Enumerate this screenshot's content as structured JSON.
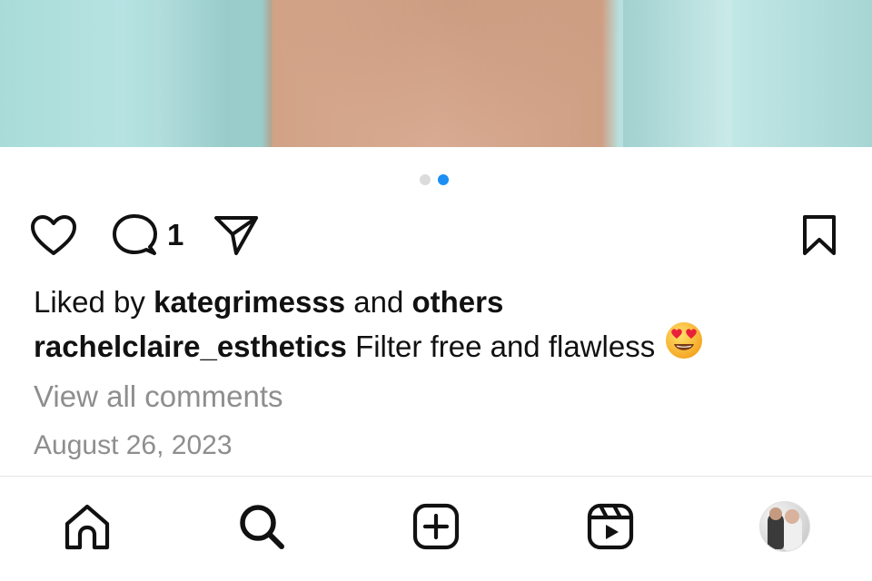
{
  "post": {
    "carousel": {
      "total": 2,
      "active_index": 1
    },
    "comment_count": "1",
    "likes": {
      "prefix": "Liked by",
      "user": "kategrimesss",
      "joiner": "and",
      "others": "others"
    },
    "caption": {
      "username": "rachelclaire_esthetics",
      "text": "Filter free and flawless"
    },
    "view_all_comments": "View all comments",
    "date": "August 26, 2023"
  },
  "colors": {
    "active_dot": "#1d8ff2",
    "inactive_dot": "#dbdbdb",
    "muted_text": "#8e8e8e"
  },
  "icons": {
    "like": "heart-icon",
    "comment": "comment-bubble-icon",
    "share": "paper-plane-icon",
    "save": "bookmark-icon",
    "emoji": "heart-eyes-emoji"
  },
  "bottom_nav": {
    "items": [
      "home-icon",
      "search-icon",
      "create-post-icon",
      "reels-icon",
      "profile-avatar"
    ]
  }
}
